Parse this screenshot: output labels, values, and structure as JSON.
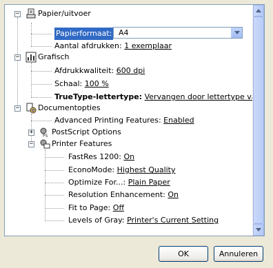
{
  "tree": {
    "paper": {
      "label": "Papier/uitvoer",
      "paper_size": {
        "label": "Papierformaat:",
        "value": "A4"
      },
      "copies": {
        "label": "Aantal afdrukken:",
        "value": "1 exemplaar"
      }
    },
    "graphics": {
      "label": "Grafisch",
      "quality": {
        "label": "Afdrukkwaliteit:",
        "value": "600 dpi"
      },
      "scale": {
        "label": "Schaal:",
        "value": "100 %"
      },
      "truetype": {
        "label": "TrueType-lettertype:",
        "value": "Vervangen door lettertype van apparaat"
      }
    },
    "document": {
      "label": "Documentopties",
      "advanced": {
        "label": "Advanced Printing Features:",
        "value": "Enabled"
      },
      "postscript": {
        "label": "PostScript Options"
      },
      "printer_features": {
        "label": "Printer Features",
        "items": [
          {
            "label": "FastRes 1200:",
            "value": "On"
          },
          {
            "label": "EconoMode:",
            "value": "Highest Quality"
          },
          {
            "label": "Optimize For...:",
            "value": "Plain Paper"
          },
          {
            "label": "Resolution Enhancement:",
            "value": "On"
          },
          {
            "label": "Fit to Page:",
            "value": "Off"
          },
          {
            "label": "Levels of Gray:",
            "value": "Printer's Current Setting"
          }
        ]
      }
    }
  },
  "buttons": {
    "ok": "OK",
    "cancel": "Annuleren"
  },
  "colors": {
    "selection": "#316AC5",
    "panel_border": "#7F9DB9",
    "dialog_bg": "#ECE9D8"
  }
}
